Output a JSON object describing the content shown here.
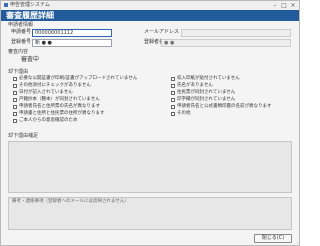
{
  "window": {
    "app_title": "申告管理システム",
    "min_glyph": "–",
    "max_glyph": "□",
    "close_glyph": "×"
  },
  "header": {
    "title": "審査履歴詳細"
  },
  "applicant_info": {
    "heading": "申請者情報",
    "applicant_id_label": "申請番号",
    "applicant_id_value": "000000001112",
    "email_label": "メールアドレス",
    "email_value": "",
    "account_label": "登録番号",
    "account_value": "新 ● ●",
    "registrant_label": "登録者名",
    "registrant_value": "● ●"
  },
  "review_status": {
    "heading": "審査内容",
    "value": "審査中"
  },
  "rejection": {
    "heading": "却下理由",
    "left_options": [
      "必要な公開証書が印刷/証書がアップロードされていません",
      "その他添付にチェックがありません",
      "日付が記入されていません",
      "戸籍抄本（謄本）が同封されていません",
      "申請者氏名と住所票の氏名が異なります",
      "申請書と住所と住民票の住所が異なります",
      "ご本人からの意思確認のため"
    ],
    "right_options": [
      "収入印紙が貼付されていません",
      "氏名がありません",
      "住民票が同封されていません",
      "印字欄が同封されていません",
      "申請者氏名と公式書類印鑑の名前が異なります",
      "その他"
    ]
  },
  "rejection_detail": {
    "heading": "却下理由補足",
    "placeholder": ""
  },
  "memo": {
    "heading": "備考・連絡事項（登録者へのメールには反映されません）"
  },
  "footer": {
    "close_label": "閉じる(C)"
  },
  "colors": {
    "accent": "#215b9c",
    "background": "#f4f4f4"
  }
}
